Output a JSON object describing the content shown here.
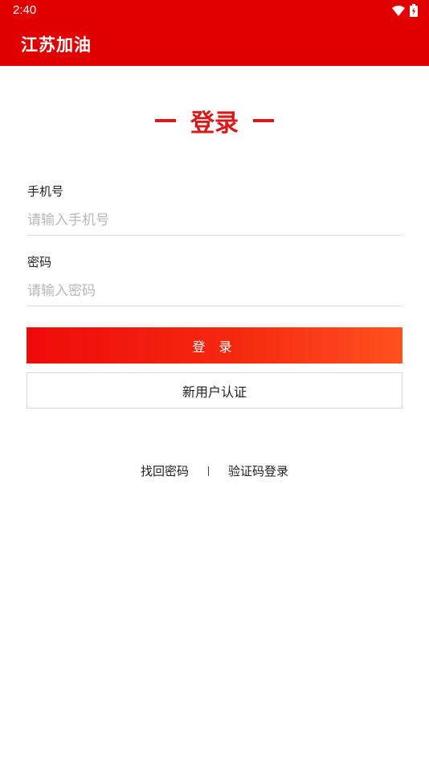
{
  "status_bar": {
    "time": "2:40",
    "wifi_icon": "wifi-icon",
    "battery_icon": "battery-charging-icon"
  },
  "app_bar": {
    "title": "江苏加油"
  },
  "login": {
    "heading": "登录",
    "phone": {
      "label": "手机号",
      "placeholder": "请输入手机号",
      "value": ""
    },
    "password": {
      "label": "密码",
      "placeholder": "请输入密码",
      "value": ""
    },
    "login_button_label": "登 录",
    "register_button_label": "新用户认证",
    "links": {
      "forgot_password": "找回密码",
      "sms_login": "验证码登录"
    }
  },
  "colors": {
    "brand_red": "#e00000",
    "heading_red": "#d71a1a",
    "button_gradient_start": "#ee0b0b",
    "button_gradient_end": "#ff5120"
  }
}
